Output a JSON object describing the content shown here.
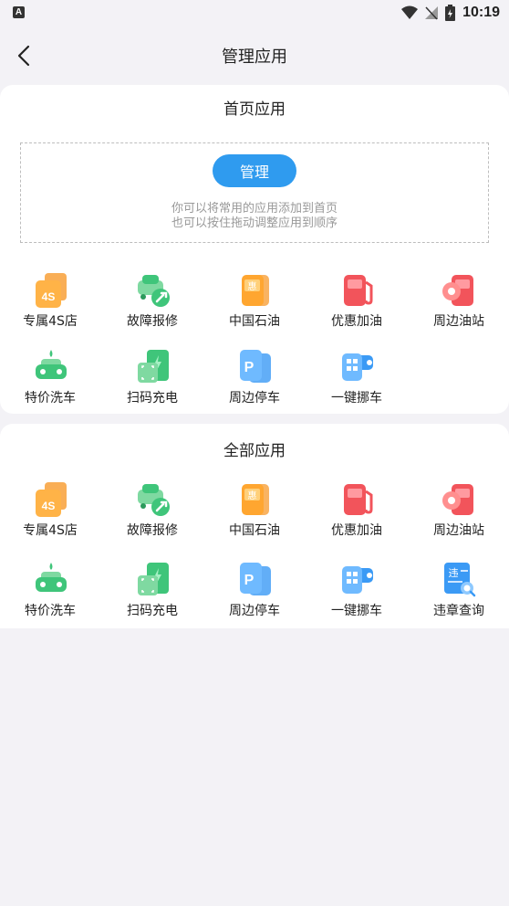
{
  "status_bar": {
    "left_icon_letter": "A",
    "time": "10:19",
    "icons": [
      "wifi-icon",
      "no-signal-icon",
      "battery-charging-icon"
    ]
  },
  "header": {
    "title": "管理应用",
    "back_icon": "chevron-left-icon"
  },
  "home_apps": {
    "title": "首页应用",
    "manage_label": "管理",
    "hint_line1": "你可以将常用的应用添加到首页",
    "hint_line2": "也可以按住拖动调整应用到顺序",
    "items": [
      {
        "label": "专属4S店",
        "icon": "4s-store-icon"
      },
      {
        "label": "故障报修",
        "icon": "car-repair-icon"
      },
      {
        "label": "中国石油",
        "icon": "sinopec-fuel-icon"
      },
      {
        "label": "优惠加油",
        "icon": "discount-fuel-icon"
      },
      {
        "label": "周边油站",
        "icon": "nearby-gas-station-icon"
      },
      {
        "label": "特价洗车",
        "icon": "car-wash-icon"
      },
      {
        "label": "扫码充电",
        "icon": "scan-charge-icon"
      },
      {
        "label": "周边停车",
        "icon": "parking-icon"
      },
      {
        "label": "一键挪车",
        "icon": "move-car-icon"
      }
    ]
  },
  "all_apps": {
    "title": "全部应用",
    "items": [
      {
        "label": "专属4S店",
        "icon": "4s-store-icon"
      },
      {
        "label": "故障报修",
        "icon": "car-repair-icon"
      },
      {
        "label": "中国石油",
        "icon": "sinopec-fuel-icon"
      },
      {
        "label": "优惠加油",
        "icon": "discount-fuel-icon"
      },
      {
        "label": "周边油站",
        "icon": "nearby-gas-station-icon"
      },
      {
        "label": "特价洗车",
        "icon": "car-wash-icon"
      },
      {
        "label": "扫码充电",
        "icon": "scan-charge-icon"
      },
      {
        "label": "周边停车",
        "icon": "parking-icon"
      },
      {
        "label": "一键挪车",
        "icon": "move-car-icon"
      },
      {
        "label": "违章查询",
        "icon": "violation-query-icon"
      }
    ]
  },
  "icon_glyphs": {
    "4s": "4S",
    "fuel_hui": "惠",
    "parking_p": "P",
    "violation_wei": "违"
  },
  "colors": {
    "accent_blue": "#2f9bef",
    "orange": "#f7931e",
    "green": "#3fc57a",
    "red": "#f2545b",
    "blue": "#3b9af5",
    "background": "#f3f2f6"
  }
}
